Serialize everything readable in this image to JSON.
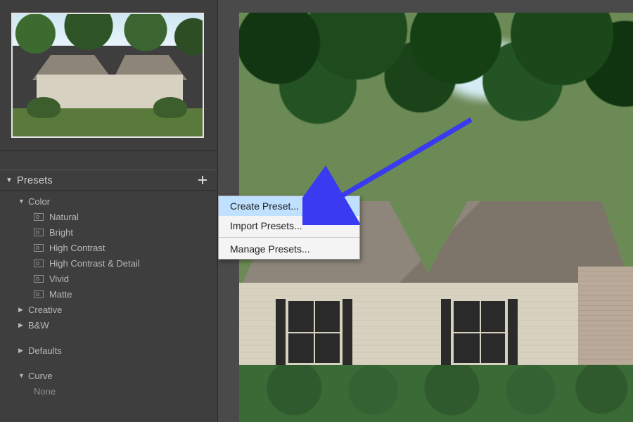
{
  "panel": {
    "title": "Presets",
    "groups": {
      "color": {
        "label": "Color",
        "items": [
          "Natural",
          "Bright",
          "High Contrast",
          "High Contrast & Detail",
          "Vivid",
          "Matte"
        ]
      },
      "creative": {
        "label": "Creative"
      },
      "bw": {
        "label": "B&W"
      },
      "defaults": {
        "label": "Defaults"
      },
      "curve": {
        "label": "Curve",
        "items": [
          "None"
        ]
      }
    }
  },
  "context_menu": {
    "create": "Create Preset...",
    "import": "Import Presets...",
    "manage": "Manage Presets..."
  }
}
